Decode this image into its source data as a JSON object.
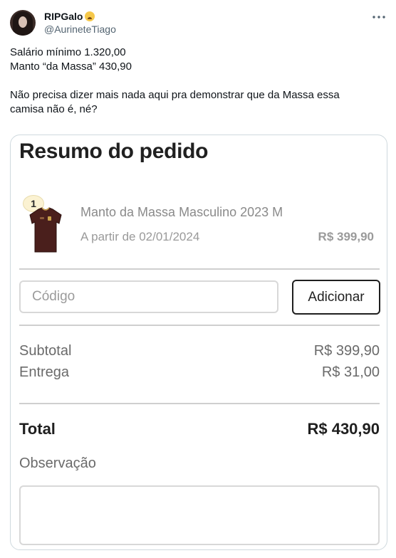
{
  "author": {
    "display_name": "RIPGalo",
    "handle": "@AurineteTiago",
    "emoji_icon": "anxious-face-emoji"
  },
  "tweet": {
    "lines": [
      "Salário mínimo 1.320,00",
      "Manto “da Massa” 430,90",
      "Não precisa dizer mais nada aqui pra demonstrar que da Massa essa",
      "camisa não é, né?"
    ]
  },
  "order": {
    "title": "Resumo do pedido",
    "item": {
      "quantity": "1",
      "name": "Manto da Massa Masculino 2023 M",
      "date": "A partir de 02/01/2024",
      "price": "R$ 399,90",
      "image_icon": "jersey-icon"
    },
    "coupon": {
      "placeholder": "Código",
      "value": "",
      "button_label": "Adicionar"
    },
    "summary": {
      "subtotal_label": "Subtotal",
      "subtotal_value": "R$ 399,90",
      "delivery_label": "Entrega",
      "delivery_value": "R$ 31,00",
      "total_label": "Total",
      "total_value": "R$ 430,90"
    },
    "notes": {
      "label": "Observação",
      "value": ""
    }
  },
  "colors": {
    "handle_gray": "#536471",
    "card_border": "#cfd9de",
    "muted_text": "#8a8a8a",
    "badge_bg": "#fbf2d2",
    "shirt_color": "#4a1f1c"
  }
}
